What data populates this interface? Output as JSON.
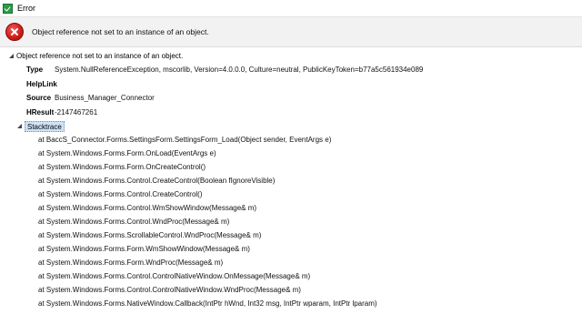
{
  "window": {
    "title": "Error",
    "app_icon": "checkbox-app-icon"
  },
  "header": {
    "icon": "error-circle-icon",
    "message": "Object reference not set to an instance of an object."
  },
  "tree": {
    "root_label": "Object reference not set to an instance of an object.",
    "properties": [
      {
        "key": "Type",
        "value": "System.NullReferenceException,  mscorlib,  Version=4.0.0.0,  Culture=neutral,  PublicKeyToken=b77a5c561934e089"
      },
      {
        "key": "HelpLink",
        "value": ""
      },
      {
        "key": "Source",
        "value": "Business_Manager_Connector"
      },
      {
        "key": "HResult",
        "value": "-2147467261"
      }
    ],
    "stacktrace_label": "Stacktrace",
    "frames": [
      "at  BaccS_Connector.Forms.SettingsForm.SettingsForm_Load(Object  sender,  EventArgs  e)",
      "at  System.Windows.Forms.Form.OnLoad(EventArgs  e)",
      "at  System.Windows.Forms.Form.OnCreateControl()",
      "at  System.Windows.Forms.Control.CreateControl(Boolean  fIgnoreVisible)",
      "at  System.Windows.Forms.Control.CreateControl()",
      "at  System.Windows.Forms.Control.WmShowWindow(Message&  m)",
      "at  System.Windows.Forms.Control.WndProc(Message&  m)",
      "at  System.Windows.Forms.ScrollableControl.WndProc(Message&  m)",
      "at  System.Windows.Forms.Form.WmShowWindow(Message&  m)",
      "at  System.Windows.Forms.Form.WndProc(Message&  m)",
      "at  System.Windows.Forms.Control.ControlNativeWindow.OnMessage(Message&  m)",
      "at  System.Windows.Forms.Control.ControlNativeWindow.WndProc(Message&  m)",
      "at  System.Windows.Forms.NativeWindow.Callback(IntPtr  hWnd,  Int32  msg,  IntPtr  wparam,  IntPtr  lparam)"
    ]
  },
  "colors": {
    "header_bg": "#f2f2f2",
    "selection_bg": "#cfe3f7",
    "error_red": "#cc1a1a"
  }
}
